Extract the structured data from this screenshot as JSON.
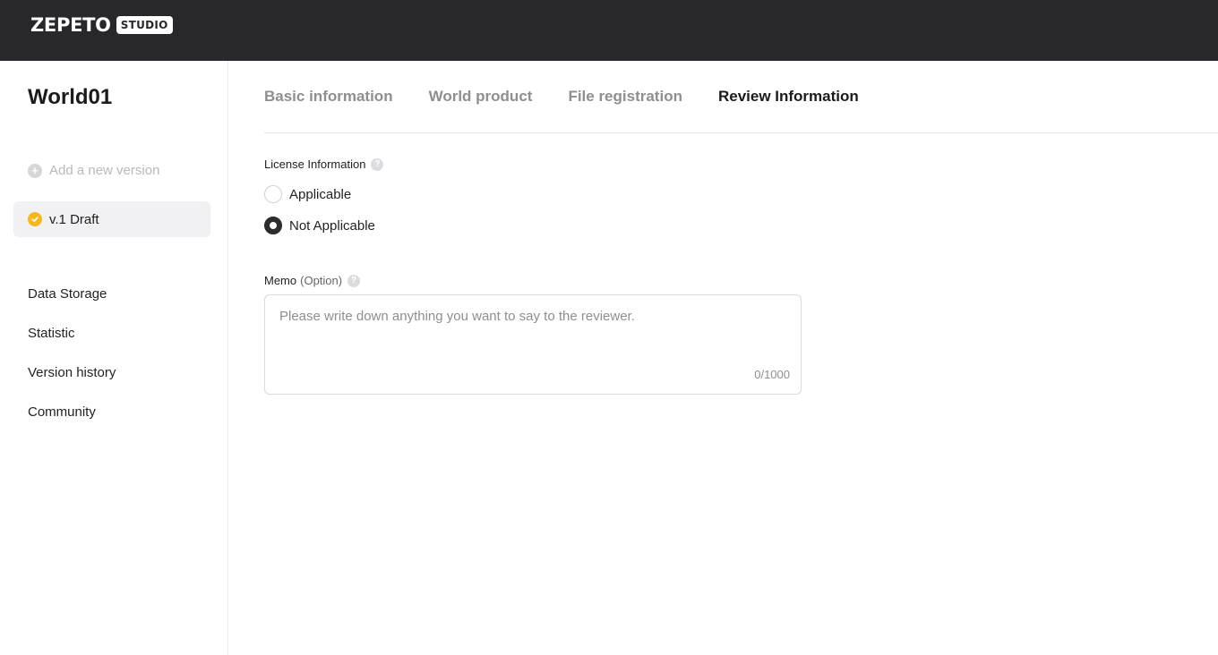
{
  "header": {
    "logo_text": "ZEPETO",
    "logo_badge": "STUDIO"
  },
  "sidebar": {
    "title": "World01",
    "add_version": "Add a new version",
    "version": {
      "label": "v.1 Draft",
      "status_color": "#f6b91c"
    },
    "nav": [
      {
        "label": "Data Storage"
      },
      {
        "label": "Statistic"
      },
      {
        "label": "Version history"
      },
      {
        "label": "Community"
      }
    ]
  },
  "tabs": [
    {
      "label": "Basic information",
      "active": false
    },
    {
      "label": "World product",
      "active": false
    },
    {
      "label": "File registration",
      "active": false
    },
    {
      "label": "Review Information",
      "active": true
    }
  ],
  "license": {
    "label": "License Information",
    "options": [
      {
        "label": "Applicable",
        "selected": false
      },
      {
        "label": "Not Applicable",
        "selected": true
      }
    ]
  },
  "memo": {
    "label": "Memo",
    "optional": "(Option)",
    "placeholder": "Please write down anything you want to say to the reviewer.",
    "value": "",
    "counter": "0/1000"
  },
  "colors": {
    "topbar": "#28272c",
    "accent": "#f6b91c",
    "active_tab": "#1b1b1b",
    "inactive_tab": "#8e8e93"
  }
}
